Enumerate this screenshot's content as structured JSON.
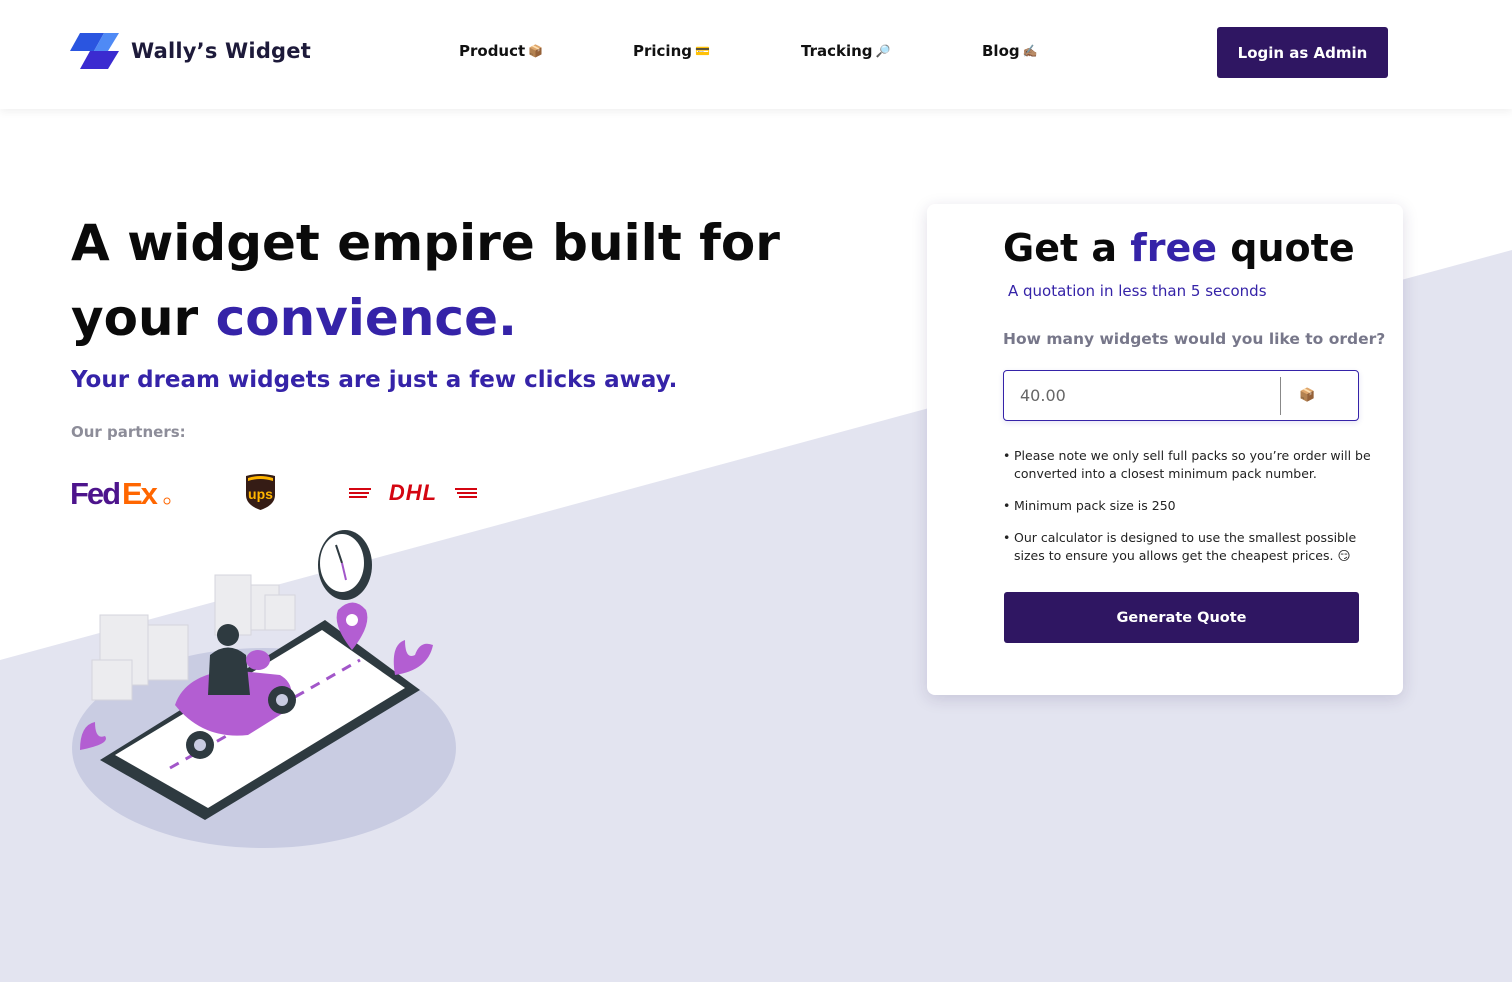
{
  "header": {
    "logo_text": "Wally’s Widget",
    "nav": [
      {
        "label": "Product",
        "emoji": "📦"
      },
      {
        "label": "Pricing",
        "emoji": "💳"
      },
      {
        "label": "Tracking",
        "emoji": "🔎"
      },
      {
        "label": "Blog",
        "emoji": "✍🏽"
      }
    ],
    "login_label": "Login as Admin"
  },
  "hero": {
    "title_line1": "A widget empire built for",
    "title_line2_prefix": "your ",
    "title_line2_accent": "convience.",
    "subtitle": "Your dream widgets are just a few clicks away.",
    "partners_label": "Our partners:",
    "partners": [
      "FedEx",
      "ups",
      "DHL"
    ]
  },
  "quote": {
    "title_prefix": "Get a ",
    "title_accent": "free",
    "title_suffix": " quote",
    "subtitle": "A quotation in less than 5 seconds",
    "question": "How many widgets would you like to order?",
    "input_placeholder": "40.00",
    "input_icon": "📦",
    "notes": [
      "Please note we only sell full packs so you’re order will be converted into a closest minimum pack number.",
      "Minimum pack size is 250",
      "Our calculator is designed to use the smallest possible sizes to ensure you allows get the cheapest prices. 😏"
    ],
    "button_label": "Generate Quote"
  },
  "colors": {
    "brand_dark": "#2f1662",
    "accent": "#3523a8",
    "background_diag": "#e3e4f0",
    "fedex_purple": "#4d148c",
    "fedex_orange": "#ff6600",
    "ups_brown": "#351c15",
    "ups_gold": "#ffb500",
    "dhl_red": "#d40511"
  }
}
